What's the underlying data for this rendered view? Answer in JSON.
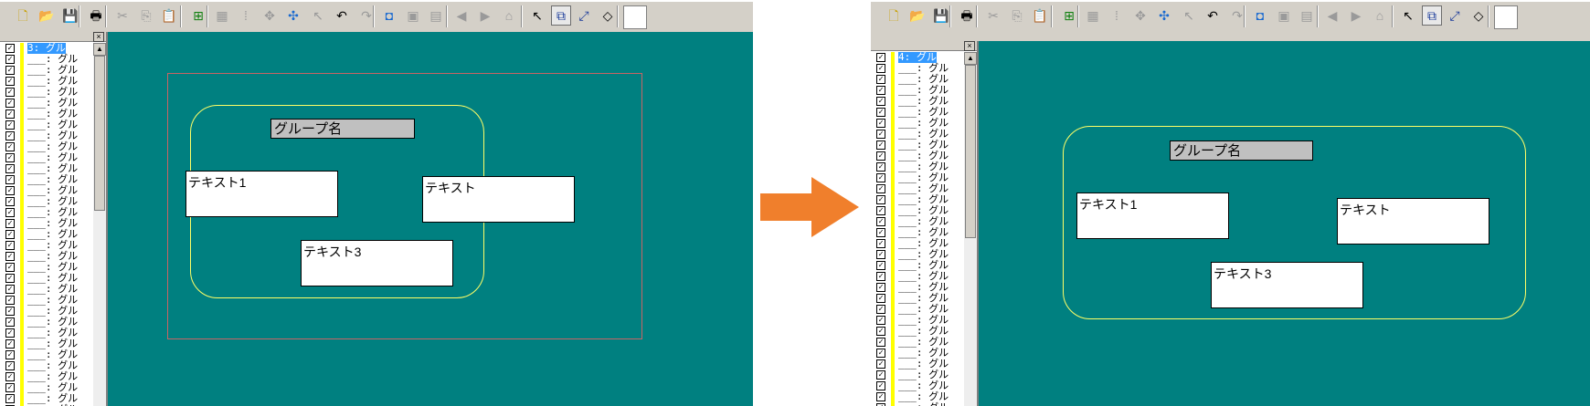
{
  "colors": {
    "canvas_bg": "#008080",
    "toolbar_bg": "#d4d0c8",
    "group_border": "#ffff66",
    "group_outline": "#c86464",
    "arrow": "#f07f2c",
    "selection": "#3399ff"
  },
  "toolbar": {
    "icons": [
      "new-icon",
      "open-icon",
      "save-icon",
      "print-icon",
      "cut-icon",
      "copy-icon",
      "paste-icon",
      "add-node-icon",
      "grid-icon",
      "tile-icon",
      "move-icon",
      "move-all-icon",
      "pointer-icon",
      "undo-icon",
      "redo-icon",
      "bring-front-icon",
      "layer-up-icon",
      "layer-down-icon",
      "back-icon",
      "forward-icon",
      "home-icon",
      "select-icon",
      "group-select-icon",
      "connect-icon",
      "fill-icon",
      "color-swatch"
    ]
  },
  "tree_close": "×",
  "before": {
    "tree": {
      "selected_label": "3: グル",
      "row_label": "___: グル",
      "row_count": 34
    },
    "group": {
      "name": "グループ名",
      "texts": [
        "テキスト1",
        "テキスト",
        "テキスト3"
      ]
    }
  },
  "after": {
    "tree": {
      "selected_label": "4: グル",
      "row_label": "___: グル",
      "row_count": 34
    },
    "group": {
      "name": "グループ名",
      "texts": [
        "テキスト1",
        "テキスト",
        "テキスト3"
      ]
    }
  }
}
